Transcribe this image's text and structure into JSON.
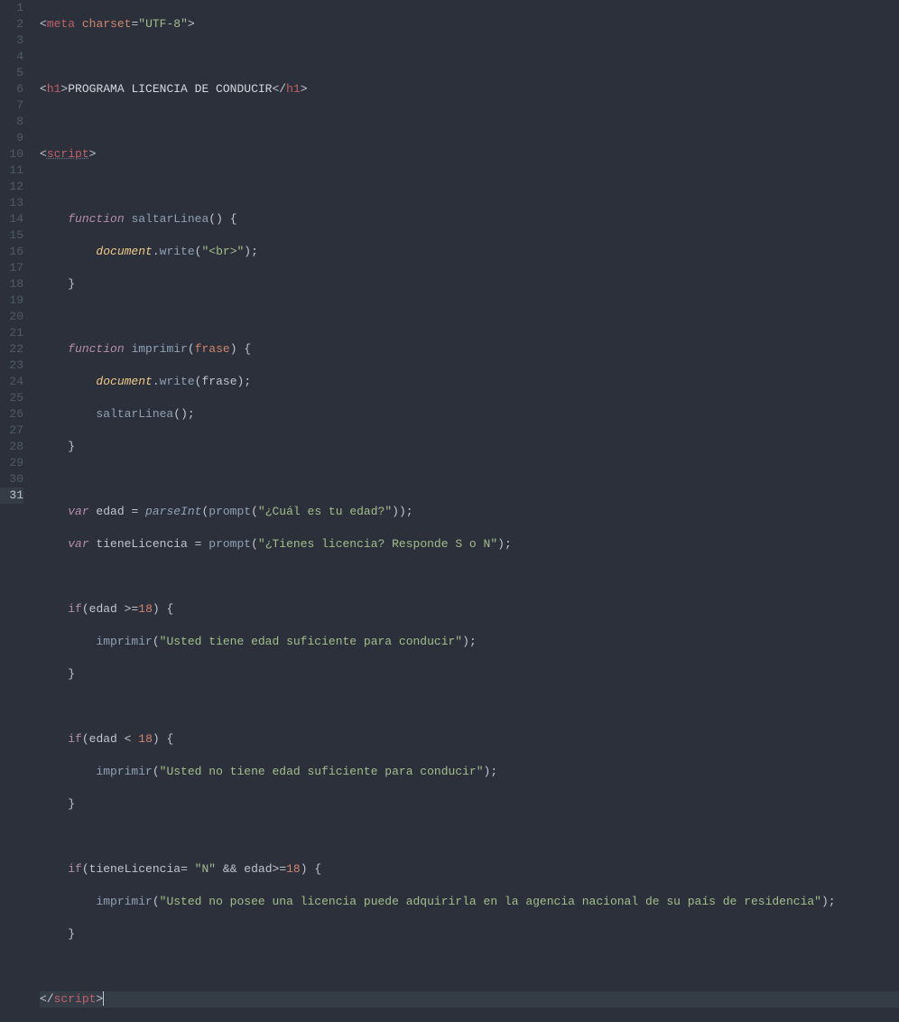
{
  "gutter": {
    "lines": [
      "1",
      "2",
      "3",
      "4",
      "5",
      "6",
      "7",
      "8",
      "9",
      "10",
      "11",
      "12",
      "13",
      "14",
      "15",
      "16",
      "17",
      "18",
      "19",
      "20",
      "21",
      "22",
      "23",
      "24",
      "25",
      "26",
      "27",
      "28",
      "29",
      "30",
      "31"
    ],
    "active_line": 31
  },
  "code": {
    "l1": {
      "tag": "meta",
      "attr_charset": "charset",
      "val_charset": "\"UTF-8\""
    },
    "l3": {
      "tag": "h1",
      "text": "PROGRAMA LICENCIA DE CONDUCIR"
    },
    "l5": {
      "tag": "script"
    },
    "l7": {
      "kw_function": "function",
      "name": "saltarLinea",
      "lp": "(",
      "rp": ")",
      "brace": " {"
    },
    "l8": {
      "obj": "document",
      "dot": ".",
      "method": "write",
      "lp": "(",
      "arg": "\"<br>\"",
      "rp": ")",
      "semi": ";"
    },
    "l9": {
      "brace": "}"
    },
    "l11": {
      "kw_function": "function",
      "name": "imprimir",
      "lp": "(",
      "param": "frase",
      "rp": ")",
      "brace": " {"
    },
    "l12": {
      "obj": "document",
      "dot": ".",
      "method": "write",
      "lp": "(",
      "arg": "frase",
      "rp": ")",
      "semi": ";"
    },
    "l13": {
      "call": "saltarLinea",
      "lp": "(",
      "rp": ")",
      "semi": ";"
    },
    "l14": {
      "brace": "}"
    },
    "l16": {
      "kw_var": "var",
      "name": " edad ",
      "eq": "= ",
      "parse": "parseInt",
      "lp": "(",
      "prompt": "prompt",
      "lp2": "(",
      "arg": "\"¿Cuál es tu edad?\"",
      "rp2": ")",
      "rp": ")",
      "semi": ";"
    },
    "l17": {
      "kw_var": "var",
      "name": " tieneLicencia ",
      "eq": "= ",
      "prompt": "prompt",
      "lp": "(",
      "arg": "\"¿Tienes licencia? Responde S o N\"",
      "rp": ")",
      "semi": ";"
    },
    "l19": {
      "kw_if": "if",
      "lp": "(",
      "var": "edad ",
      "op": ">=",
      "num": "18",
      "rp": ")",
      "brace": " {"
    },
    "l20": {
      "call": "imprimir",
      "lp": "(",
      "arg": "\"Usted tiene edad suficiente para conducir\"",
      "rp": ")",
      "semi": ";"
    },
    "l21": {
      "brace": "}"
    },
    "l23": {
      "kw_if": "if",
      "lp": "(",
      "var": "edad ",
      "op": "<",
      "num": " 18",
      "rp": ")",
      "brace": " {"
    },
    "l24": {
      "call": "imprimir",
      "lp": "(",
      "arg": "\"Usted no tiene edad suficiente para conducir\"",
      "rp": ")",
      "semi": ";"
    },
    "l25": {
      "brace": "}"
    },
    "l27": {
      "kw_if": "if",
      "lp": "(",
      "var1": "tieneLicencia",
      "eq": "=",
      "str": " \"N\" ",
      "and": "&&",
      "var2": " edad",
      "op": ">=",
      "num": "18",
      "rp": ")",
      "brace": " {"
    },
    "l28": {
      "call": "imprimir",
      "lp": "(",
      "arg": "\"Usted no posee una licencia puede adquirirla en la agencia nacional de su país de residencia\"",
      "rp": ")",
      "semi": ";"
    },
    "l29": {
      "brace": "}"
    },
    "l31": {
      "close": "</",
      "tag": "script",
      "gt": ">"
    }
  }
}
